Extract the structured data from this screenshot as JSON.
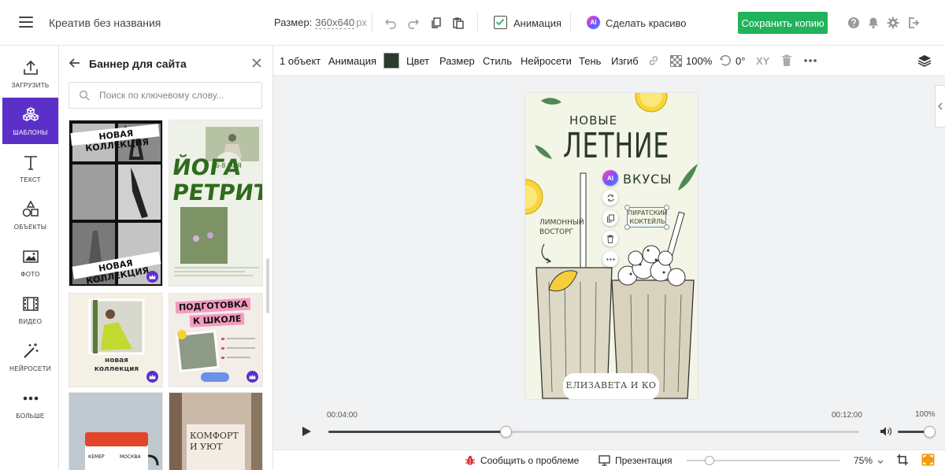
{
  "header": {
    "document_title": "Креатив без названия",
    "size_label": "Размер:",
    "size_value": "360x640",
    "size_unit": "px",
    "animation_label": "Анимация",
    "ai_badge": "AI",
    "beautify_label": "Сделать красиво",
    "save_copy_label": "Сохранить копию"
  },
  "leftnav": {
    "items": [
      {
        "label": "ЗАГРУЗИТЬ",
        "icon": "upload-icon"
      },
      {
        "label": "ШАБЛОНЫ",
        "icon": "templates-icon"
      },
      {
        "label": "ТЕКСТ",
        "icon": "text-icon"
      },
      {
        "label": "ОБЪЕКТЫ",
        "icon": "shapes-icon"
      },
      {
        "label": "ФОТО",
        "icon": "photo-icon"
      },
      {
        "label": "ВИДЕО",
        "icon": "video-icon"
      },
      {
        "label": "НЕЙРОСЕТИ",
        "icon": "magic-wand-icon"
      },
      {
        "label": "БОЛЬШЕ",
        "icon": "more-dots-icon"
      }
    ],
    "active_index": 1
  },
  "panel": {
    "title": "Баннер для сайта",
    "search_placeholder": "Поиск по ключевому слову...",
    "templates": {
      "t1_title_top": "НОВАЯ КОЛЛЕКЦИЯ",
      "t1_title_bottom": "НОВАЯ КОЛЛЕКЦИЯ",
      "t2_title_line1": "ЙОГА",
      "t2_title_line2": "РЕТРИТ",
      "t2_date": "6-8 МАЯ",
      "t3_title_line1": "новая",
      "t3_title_line2": "коллекция",
      "t4_title_line1": "ПОДГОТОВКА",
      "t4_title_line2": "К ШКОЛЕ",
      "t6_title_line1": "КОМФОРТ",
      "t6_title_line2": "И УЮТ",
      "t5_label_from": "КЕМЕР",
      "t5_label_to": "МОСКВА"
    }
  },
  "toolbar": {
    "object_count": "1 объект",
    "animation": "Анимация",
    "color_value": "#2b3a2c",
    "color_label": "Цвет",
    "size": "Размер",
    "style": "Стиль",
    "neural": "Нейросети",
    "shadow": "Тень",
    "curve": "Изгиб",
    "opacity": "100%",
    "rotation": "0°",
    "xy": "XY"
  },
  "artboard": {
    "title_line1": "НОВЫЕ",
    "title_line2": "ЛЕТНИЕ",
    "title_line3": "ВКУСЫ",
    "left_caption_line1": "ЛИМОННЫЙ",
    "left_caption_line2": "ВОСТОРГ",
    "selected_text_line1": "ПИРАТСКИЙ",
    "selected_text_line2": "КОКТЕЙЛЬ",
    "footer": "ЕЛИЗАВЕТА И КО",
    "ai_badge": "AI"
  },
  "timeline": {
    "current_time": "00:04:00",
    "total_time": "00:12:00",
    "volume": "100%",
    "progress": 0.3333,
    "volume_level": 1.0
  },
  "statusbar": {
    "report_problem": "Сообщить о проблеме",
    "presentation": "Презентация",
    "zoom_value": "75%",
    "zoom_level": 0.15
  }
}
